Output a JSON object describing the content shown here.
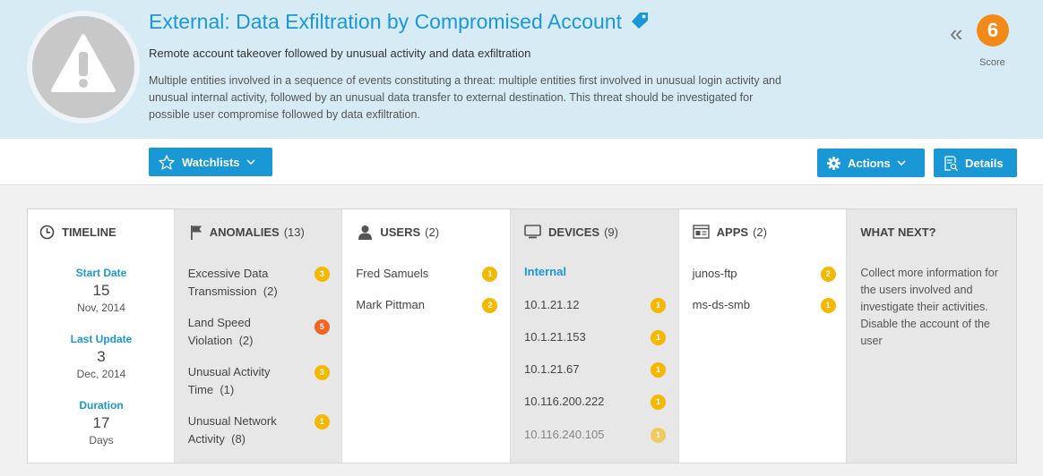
{
  "header": {
    "title": "External: Data Exfiltration by Compromised Account",
    "subtitle": "Remote account takeover followed by unusual activity and data exfiltration",
    "description": "Multiple entities involved in a sequence of events constituting a threat: multiple entities first involved in unusual login activity and unusual internal activity, followed by an unusual data transfer to external destination. This threat should be investigated for possible user compromise followed by data exfiltration.",
    "score": "6",
    "score_label": "Score",
    "score_color": "#f28a1a",
    "icons": {
      "alert": "warning-triangle-icon",
      "tag": "tag-icon",
      "collapse": "double-chevron-left-icon"
    }
  },
  "toolbar": {
    "watchlists_label": "Watchlists",
    "actions_label": "Actions",
    "details_label": "Details",
    "accent": "#1a98d5"
  },
  "timeline": {
    "heading": "TIMELINE",
    "start": {
      "label": "Start Date",
      "value": "15",
      "sub": "Nov, 2014"
    },
    "last_update": {
      "label": "Last Update",
      "value": "3",
      "sub": "Dec, 2014"
    },
    "duration": {
      "label": "Duration",
      "value": "17",
      "sub": "Days"
    }
  },
  "anomalies": {
    "heading": "ANOMALIES",
    "count": "(13)",
    "items": [
      {
        "label": "Excessive Data Transmission",
        "count": "(2)",
        "score": "3",
        "color": "#f5b800"
      },
      {
        "label": "Land Speed Violation",
        "count": "(2)",
        "score": "5",
        "color": "#f26522"
      },
      {
        "label": "Unusual Activity Time",
        "count": "(1)",
        "score": "3",
        "color": "#f5b800"
      },
      {
        "label": "Unusual Network Activity",
        "count": "(8)",
        "score": "1",
        "color": "#f5b800"
      }
    ]
  },
  "users": {
    "heading": "USERS",
    "count": "(2)",
    "items": [
      {
        "name": "Fred Samuels",
        "score": "1"
      },
      {
        "name": "Mark Pittman",
        "score": "2"
      }
    ]
  },
  "devices": {
    "heading": "DEVICES",
    "count": "(9)",
    "group": "Internal",
    "items": [
      {
        "ip": "10.1.21.12",
        "score": "1"
      },
      {
        "ip": "10.1.21.153",
        "score": "1"
      },
      {
        "ip": "10.1.21.67",
        "score": "1"
      },
      {
        "ip": "10.116.200.222",
        "score": "1"
      },
      {
        "ip": "10.116.240.105",
        "score": "1"
      }
    ]
  },
  "apps": {
    "heading": "APPS",
    "count": "(2)",
    "items": [
      {
        "name": "junos-ftp",
        "score": "2"
      },
      {
        "name": "ms-ds-smb",
        "score": "1"
      }
    ]
  },
  "what_next": {
    "heading": "WHAT NEXT?",
    "text": "Collect more information for the users involved and investigate their activities. Disable the account of the user"
  }
}
